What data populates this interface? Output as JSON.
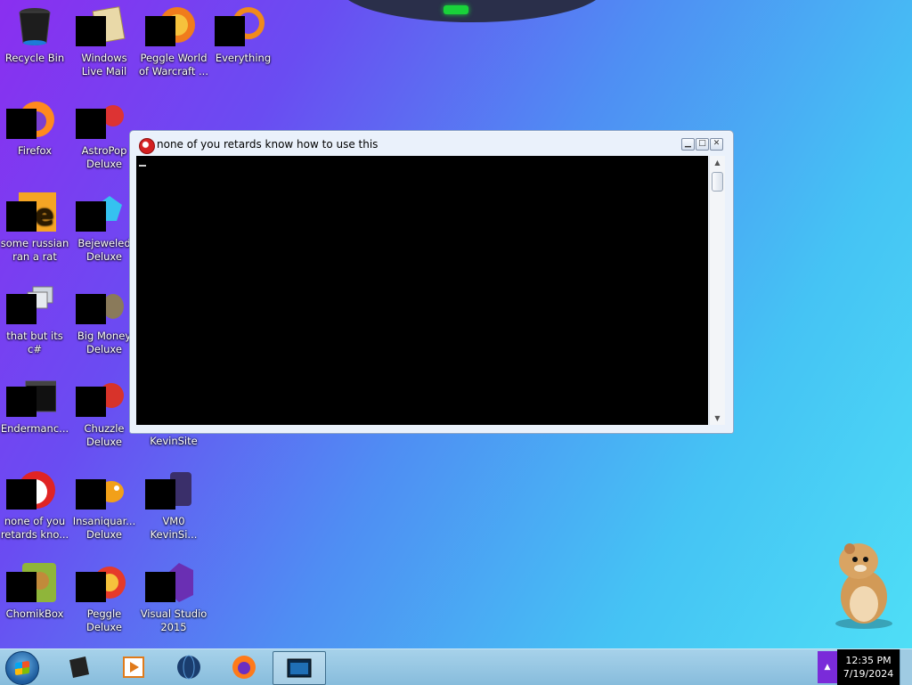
{
  "desktop": {
    "icons": [
      {
        "id": "recycle",
        "label": "Recycle Bin"
      },
      {
        "id": "wlmail",
        "label": "Windows Live Mail"
      },
      {
        "id": "peggle-wow",
        "label": "Peggle World of Warcraft ..."
      },
      {
        "id": "everything",
        "label": "Everything"
      },
      {
        "id": "firefox",
        "label": "Firefox"
      },
      {
        "id": "astropop",
        "label": "AstroPop Deluxe"
      },
      {
        "id": "russian",
        "label": "some russian ran a rat"
      },
      {
        "id": "bejeweled",
        "label": "Bejeweled Deluxe"
      },
      {
        "id": "csharp",
        "label": "that but its c#"
      },
      {
        "id": "bigmoney",
        "label": "Big Money Deluxe"
      },
      {
        "id": "endermanc",
        "label": "Endermanc..."
      },
      {
        "id": "chuzzle",
        "label": "Chuzzle Deluxe"
      },
      {
        "id": "kevinsite",
        "label": "KevinSite"
      },
      {
        "id": "noneofyou",
        "label": "none of you retards kno..."
      },
      {
        "id": "insaniquarium",
        "label": "Insaniquar... Deluxe"
      },
      {
        "id": "vm0",
        "label": "VM0 KevinSi..."
      },
      {
        "id": "chomikbox",
        "label": "ChomikBox"
      },
      {
        "id": "peggle",
        "label": "Peggle Deluxe"
      },
      {
        "id": "vs2015",
        "label": "Visual Studio 2015"
      }
    ]
  },
  "window": {
    "title": "none of you retards know how to use this",
    "minimize_glyph": "▁",
    "maximize_glyph": "□",
    "close_glyph": "✕",
    "scroll_up_glyph": "▲",
    "scroll_down_glyph": "▼"
  },
  "taskbar": {
    "tray_arrow_glyph": "▲",
    "clock_time": "12:35 PM",
    "clock_date": "7/19/2024"
  },
  "colors": {
    "console_bg": "#000000",
    "tray_accent": "#7a2bd9"
  }
}
